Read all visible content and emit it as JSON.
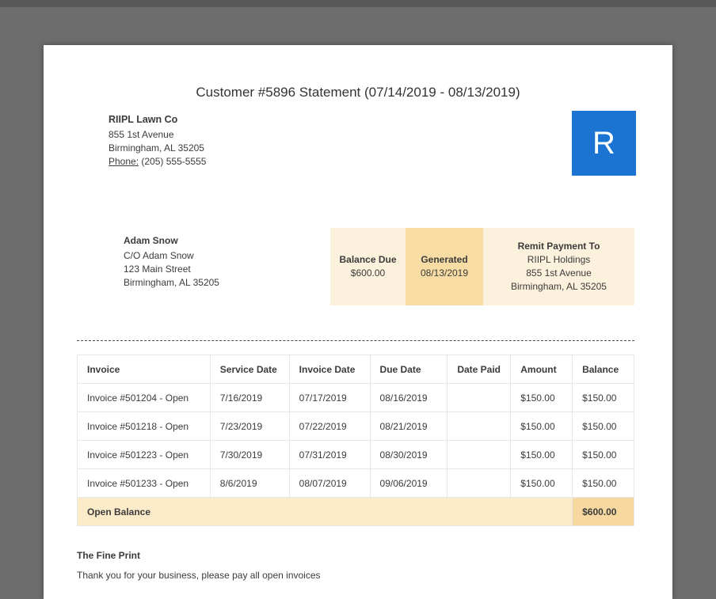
{
  "page": {
    "title": "Customer #5896 Statement (07/14/2019 - 08/13/2019)"
  },
  "company": {
    "name": "RIIPL Lawn Co",
    "address1": "855 1st Avenue",
    "address2": "Birmingham, AL 35205",
    "phone_label": "Phone:",
    "phone": "(205) 555-5555",
    "logo_letter": "R"
  },
  "customer": {
    "name": "Adam Snow",
    "line1": "C/O Adam Snow",
    "line2": "123 Main Street",
    "line3": "Birmingham, AL 35205"
  },
  "summary": {
    "balance_due_label": "Balance Due",
    "balance_due_value": "$600.00",
    "generated_label": "Generated",
    "generated_value": "08/13/2019",
    "remit_label": "Remit Payment To",
    "remit_name": "RIIPL Holdings",
    "remit_address1": "855 1st Avenue",
    "remit_address2": "Birmingham, AL 35205"
  },
  "table": {
    "headers": [
      "Invoice",
      "Service Date",
      "Invoice Date",
      "Due Date",
      "Date Paid",
      "Amount",
      "Balance"
    ],
    "rows": [
      [
        "Invoice #501204 - Open",
        "7/16/2019",
        "07/17/2019",
        "08/16/2019",
        "",
        "$150.00",
        "$150.00"
      ],
      [
        "Invoice #501218 - Open",
        "7/23/2019",
        "07/22/2019",
        "08/21/2019",
        "",
        "$150.00",
        "$150.00"
      ],
      [
        "Invoice #501223 - Open",
        "7/30/2019",
        "07/31/2019",
        "08/30/2019",
        "",
        "$150.00",
        "$150.00"
      ],
      [
        "Invoice #501233 - Open",
        "8/6/2019",
        "08/07/2019",
        "09/06/2019",
        "",
        "$150.00",
        "$150.00"
      ]
    ],
    "footer": {
      "label": "Open Balance",
      "balance": "$600.00"
    }
  },
  "fine_print": {
    "title": "The Fine Print",
    "text": "Thank you for your business, please pay all open invoices"
  },
  "colors": {
    "logo_blue": "#1b74d2",
    "summary_bg": "#fcf1dc",
    "summary_highlight": "#f7dca4",
    "footer_row_bg": "#fcebc9",
    "footer_balance_bg": "#f6d8a0",
    "background_gray": "#6d6d6d"
  }
}
